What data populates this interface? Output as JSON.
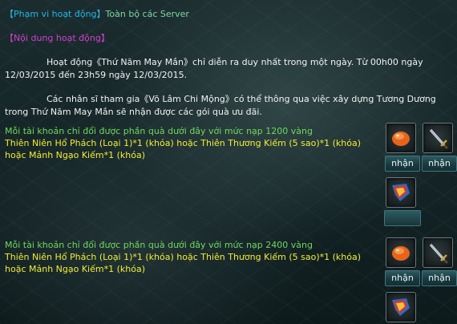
{
  "scope": {
    "label": "【Phạm vi hoạt động】",
    "value": "Toàn bộ các Server"
  },
  "content": {
    "label": "【Nội dung hoạt động】",
    "paragraph1_line1": "Hoạt động《Thứ Năm May Mắn》chỉ diễn ra duy nhất trong một ngày. Từ 00h00 ngày",
    "paragraph1_line2": "12/03/2015 đến 23h59 ngày 12/03/2015.",
    "paragraph2_line1": "Các nhân sĩ tham gia《Võ Lâm Chi Mộng》có thể thông qua việc xây dựng Tương Dương",
    "paragraph2_line2": "trong Thứ Năm May Mắn sẽ nhận được các gói quà ưu đãi."
  },
  "rewards": [
    {
      "condition": "Mỗi tài khoản chỉ đổi được phần quà dưới đây với mức nạp 1200 vàng",
      "items_line1": "Thiên Niên Hổ Phách (Loại 1)*1 (khóa) hoặc Thiên Thương Kiếm (5 sao)*1 (khóa)",
      "items_line2": "hoặc Mảnh Ngạo Kiếm*1 (khóa)",
      "button_label": "nhận"
    },
    {
      "condition": "Mỗi tài khoản chỉ đổi được phần quà dưới đây với mức nạp 2400 vàng",
      "items_line1": "Thiên Niên Hổ Phách (Loại 1)*1 (khóa) hoặc Thiên Thương Kiếm (5 sao)*1 (khóa)",
      "items_line2": "hoặc Mảnh Ngạo Kiếm*1 (khóa)",
      "button_label": "nhận"
    }
  ],
  "icons": {
    "amber": "amber-stone-icon",
    "sword": "sword-icon",
    "fragment": "sword-fragment-icon"
  },
  "colors": {
    "scope_label": "#22b8e8",
    "content_label": "#d23fd2",
    "condition_text": "#6fd85c",
    "items_text": "#f0ee33",
    "body_text": "#f2f2f2"
  }
}
